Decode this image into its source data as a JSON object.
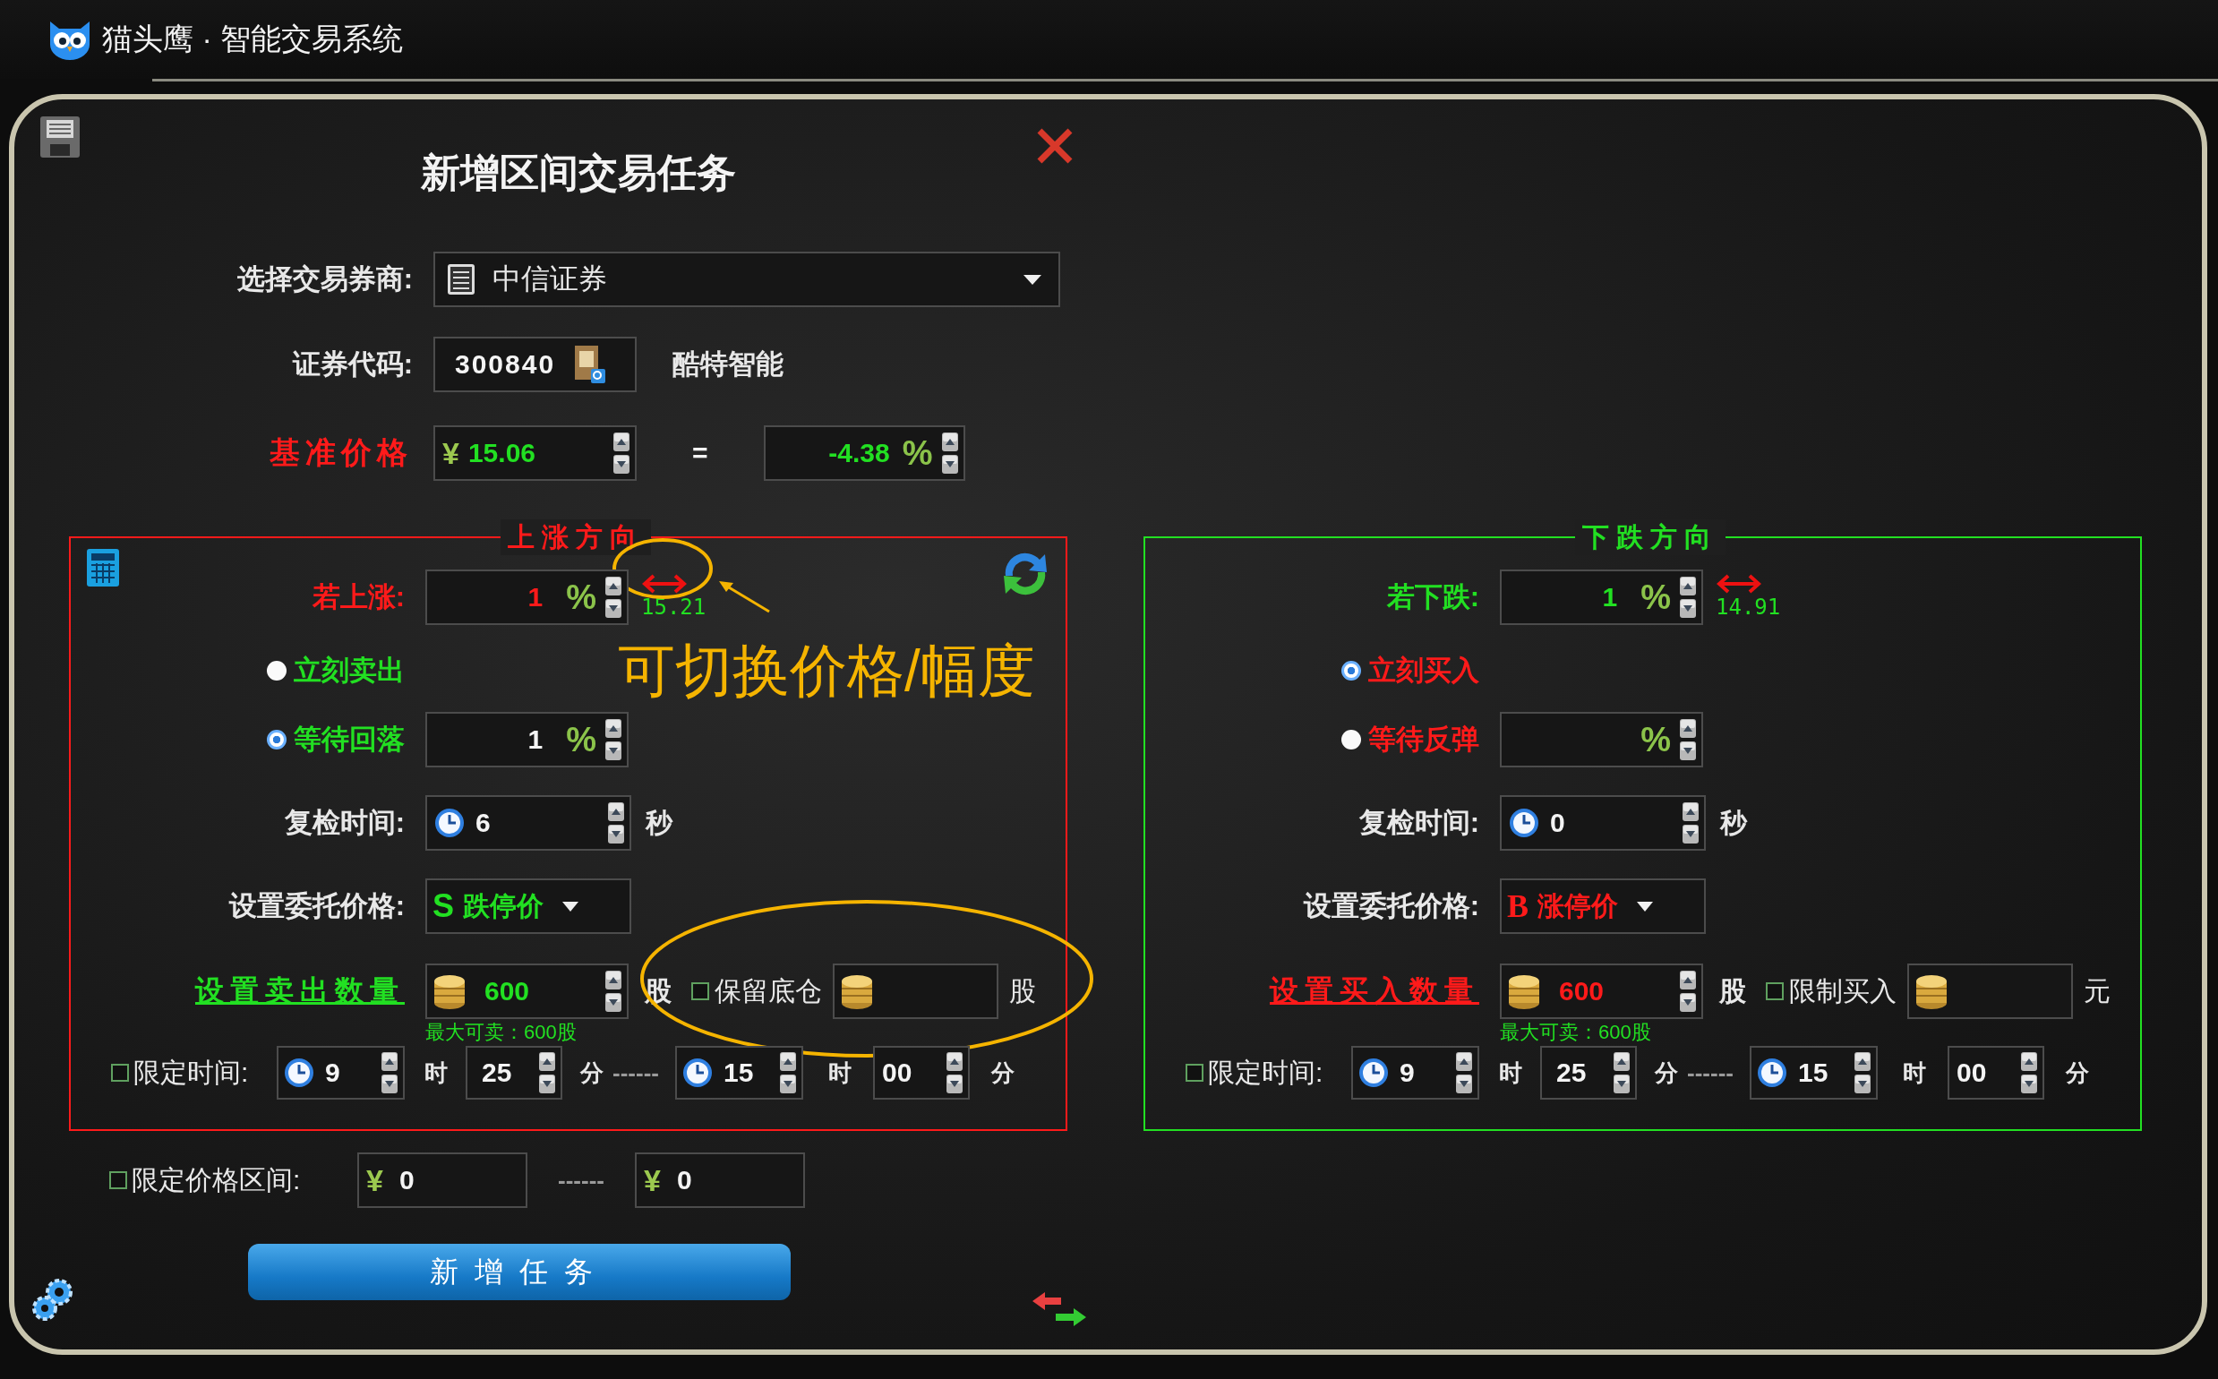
{
  "app_title": "猫头鹰 · 智能交易系统",
  "dialog": {
    "title": "新增区间交易任务"
  },
  "broker": {
    "label": "选择交易券商:",
    "value": "中信证券"
  },
  "code": {
    "label": "证券代码:",
    "value": "300840",
    "name": "酷特智能"
  },
  "base_price": {
    "label": "基准价格",
    "currency": "¥",
    "value": "15.06",
    "equals": "=",
    "pct_value": "-4.38",
    "pct_unit": "%"
  },
  "panels": [
    {
      "kind": "rise",
      "title": "上涨方向",
      "trigger": {
        "label": "若上涨:",
        "value": "1",
        "unit": "%",
        "target_price": "15.21"
      },
      "options": [
        {
          "label": "立刻卖出",
          "selected": false
        },
        {
          "label": "等待回落",
          "selected": true,
          "value": "1",
          "unit": "%"
        }
      ],
      "recheck": {
        "label": "复检时间:",
        "value": "6",
        "unit": "秒"
      },
      "order_price": {
        "label": "设置委托价格:",
        "letter": "S",
        "value": "跌停价"
      },
      "quantity": {
        "label": "设置卖出数量",
        "value": "600",
        "unit": "股",
        "hint": "最大可卖：600股"
      },
      "extra": {
        "label": "保留底仓",
        "checked": false,
        "unit": "股"
      },
      "time_limit": {
        "label": "限定时间:",
        "checked": false,
        "start_hour": "9",
        "hour_unit": "时",
        "start_minute": "25",
        "minute_unit": "分",
        "separator": "------",
        "end_hour": "15",
        "end_hour_unit": "时",
        "end_minute": "00",
        "end_minute_unit": "分"
      }
    },
    {
      "kind": "fall",
      "title": "下跌方向",
      "trigger": {
        "label": "若下跌:",
        "value": "1",
        "unit": "%",
        "target_price": "14.91"
      },
      "options": [
        {
          "label": "立刻买入",
          "selected": true
        },
        {
          "label": "等待反弹",
          "selected": false,
          "unit": "%"
        }
      ],
      "recheck": {
        "label": "复检时间:",
        "value": "0",
        "unit": "秒"
      },
      "order_price": {
        "label": "设置委托价格:",
        "letter": "B",
        "value": "涨停价"
      },
      "quantity": {
        "label": "设置买入数量",
        "value": "600",
        "unit": "股",
        "hint": "最大可卖：600股"
      },
      "extra": {
        "label": "限制买入",
        "checked": false,
        "unit": "元"
      },
      "time_limit": {
        "label": "限定时间:",
        "checked": false,
        "start_hour": "9",
        "hour_unit": "时",
        "start_minute": "25",
        "minute_unit": "分",
        "separator": "------",
        "end_hour": "15",
        "end_hour_unit": "时",
        "end_minute": "00",
        "end_minute_unit": "分"
      }
    }
  ],
  "annotation": {
    "text": "可切换价格/幅度"
  },
  "price_limit": {
    "label": "限定价格区间:",
    "checked": false,
    "currency_from": "¥",
    "from": "0",
    "separator": "------",
    "currency_to": "¥",
    "to": "0"
  },
  "submit": {
    "label": "新增任务"
  }
}
